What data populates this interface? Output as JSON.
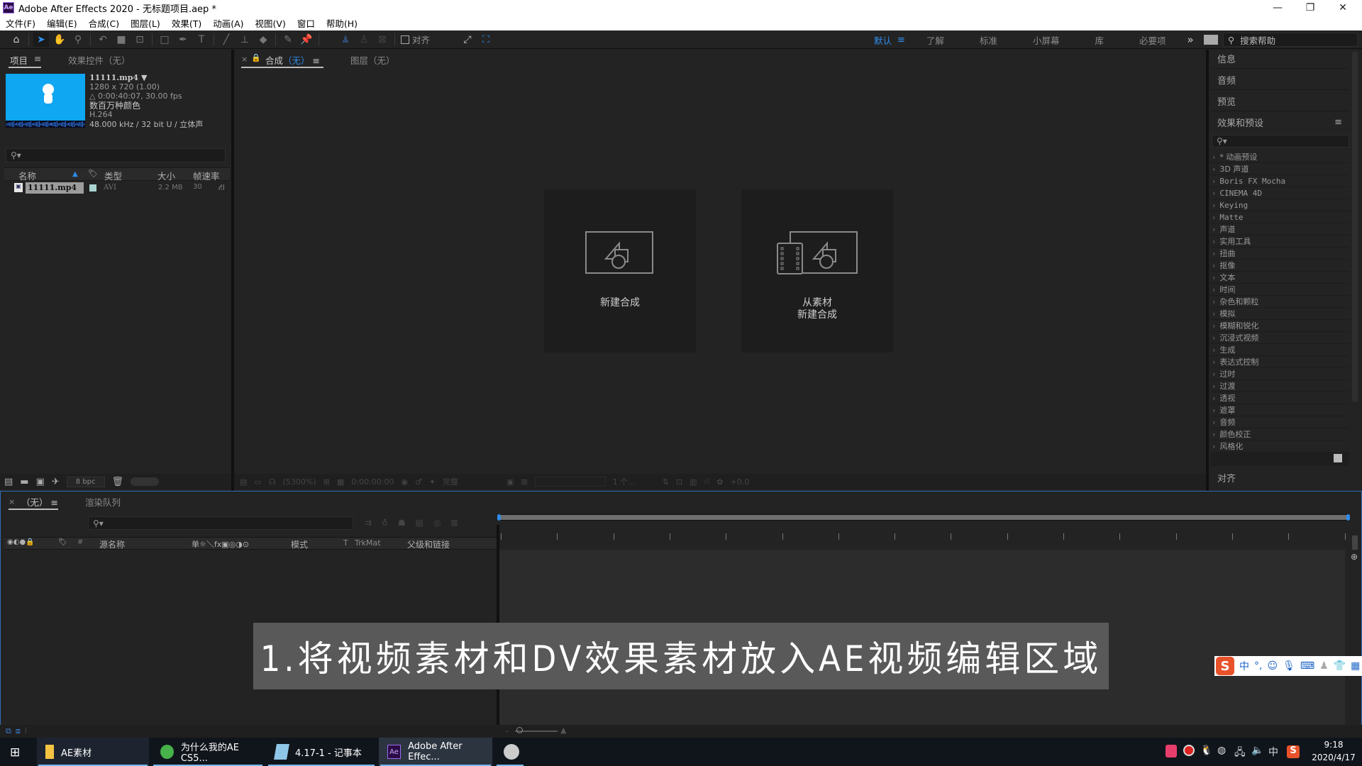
{
  "window": {
    "title": "Adobe After Effects 2020 - 无标题项目.aep *",
    "app_icon": "Ae",
    "controls": {
      "minimize": "—",
      "restore": "❐",
      "close": "✕"
    }
  },
  "menu": [
    "文件(F)",
    "编辑(E)",
    "合成(C)",
    "图层(L)",
    "效果(T)",
    "动画(A)",
    "视图(V)",
    "窗口",
    "帮助(H)"
  ],
  "toolbar": {
    "snap_label": "对齐",
    "workspaces": [
      "默认",
      "了解",
      "标准",
      "小屏幕",
      "库",
      "必要项"
    ],
    "active_workspace": "默认",
    "more": "»",
    "search_help_placeholder": "搜索帮助"
  },
  "project_panel": {
    "tabs": [
      "项目",
      "效果控件（无）"
    ],
    "menu_icon": "≡",
    "footage": {
      "name": "11111.mp4",
      "resolution": "1280 x 720 (1.00)",
      "duration": "△ 0:00:40:07, 30.00 fps",
      "colors": "数百万种颜色",
      "codec": "H.264",
      "audio": "48.000 kHz / 32 bit U / 立体声"
    },
    "search_placeholder": "",
    "columns": [
      "名称",
      "类型",
      "大小",
      "帧速率"
    ],
    "rows": [
      {
        "name": "11111.mp4",
        "type": "AVI",
        "size": "2.2 MB",
        "fps": "30",
        "label_color": "#a9d5d0"
      }
    ],
    "bpc": "8 bpc"
  },
  "comp_panel": {
    "tabs": [
      {
        "label": "合成",
        "suffix": "（无）"
      },
      {
        "label": "图层（无）"
      }
    ],
    "cards": [
      {
        "label_line1": "新建合成",
        "label_line2": ""
      },
      {
        "label_line1": "从素材",
        "label_line2": "新建合成"
      }
    ],
    "footer": {
      "zoom": "(5300%)",
      "timecode": "0:00:00:00",
      "resolution": "完整",
      "views": "1 个...",
      "exposure": "+0.0"
    }
  },
  "right_panel": {
    "headers": [
      "信息",
      "音频",
      "预览"
    ],
    "effects_title": "效果和预设",
    "effects": [
      "* 动画预设",
      "3D 声道",
      "Boris FX Mocha",
      "CINEMA 4D",
      "Keying",
      "Matte",
      "声道",
      "实用工具",
      "扭曲",
      "抠像",
      "文本",
      "时间",
      "杂色和颗粒",
      "模拟",
      "模糊和锐化",
      "沉浸式视频",
      "生成",
      "表达式控制",
      "过时",
      "过渡",
      "透视",
      "遮罩",
      "音频",
      "颜色校正",
      "风格化"
    ],
    "align_label": "对齐"
  },
  "timeline": {
    "tabs": [
      "（无）",
      "渲染队列"
    ],
    "columns": {
      "source": "源名称",
      "switches": "单☼＼fx▣◎◑⊙",
      "mode": "模式",
      "trkmat_t": "T",
      "trkmat": "TrkMat",
      "parent": "父级和链接",
      "num": "#"
    }
  },
  "subtitle": "1.将视频素材和DV效果素材放入AE视频编辑区域",
  "ime_bar": [
    "中",
    "°,",
    "☺",
    "🎤",
    "⌨"
  ],
  "taskbar": {
    "items": [
      {
        "label": "AE素材"
      },
      {
        "label": "为什么我的AE CS5..."
      },
      {
        "label": "4.17-1 - 记事本"
      },
      {
        "label": "Adobe After Effec..."
      }
    ],
    "tray": {
      "ime": "中",
      "time": "9:18",
      "date": "2020/4/17"
    }
  },
  "colors": {
    "accent": "#2d8ceb",
    "thumb": "#0fa6f2",
    "subtitle_bg": "#595959",
    "panel": "#232323"
  }
}
